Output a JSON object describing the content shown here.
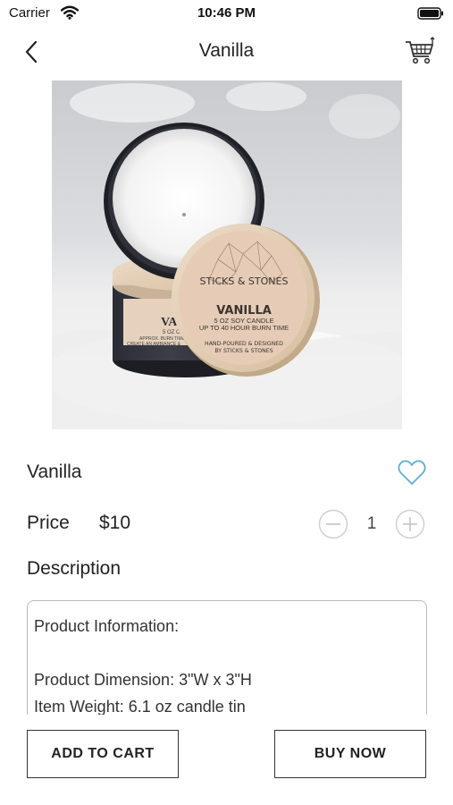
{
  "status_bar": {
    "carrier": "Carrier",
    "time": "10:46 PM"
  },
  "nav": {
    "title": "Vanilla",
    "back_icon": "chevron-left-icon",
    "cart_icon": "shopping-cart-icon"
  },
  "product": {
    "image": {
      "brand": "STICKS & STONES",
      "label_title": "VANILLA",
      "label_line1": "5 OZ SOY CANDLE",
      "label_line2": "UP TO 40 HOUR BURN TIME",
      "label_line3": "HAND-POURED & DESIGNED",
      "label_line4": "BY STICKS & STONES",
      "back_label_title": "VANI",
      "back_label_line1": "5 OZ CAN",
      "back_label_line2": "APPROX. BURN TIME",
      "back_label_line3": "CREATE AN AMBIANCE &"
    },
    "name": "Vanilla",
    "price_label": "Price",
    "price": "$10",
    "quantity": "1",
    "favorite_icon": "heart-outline-icon",
    "accent_color": "#5aaed8"
  },
  "description": {
    "label": "Description",
    "lines": [
      "Product Information:",
      "",
      "Product Dimension:  3\"W x 3\"H",
      "Item Weight:  6.1 oz candle tin"
    ]
  },
  "actions": {
    "add_to_cart": "ADD TO CART",
    "buy_now": "BUY NOW"
  }
}
